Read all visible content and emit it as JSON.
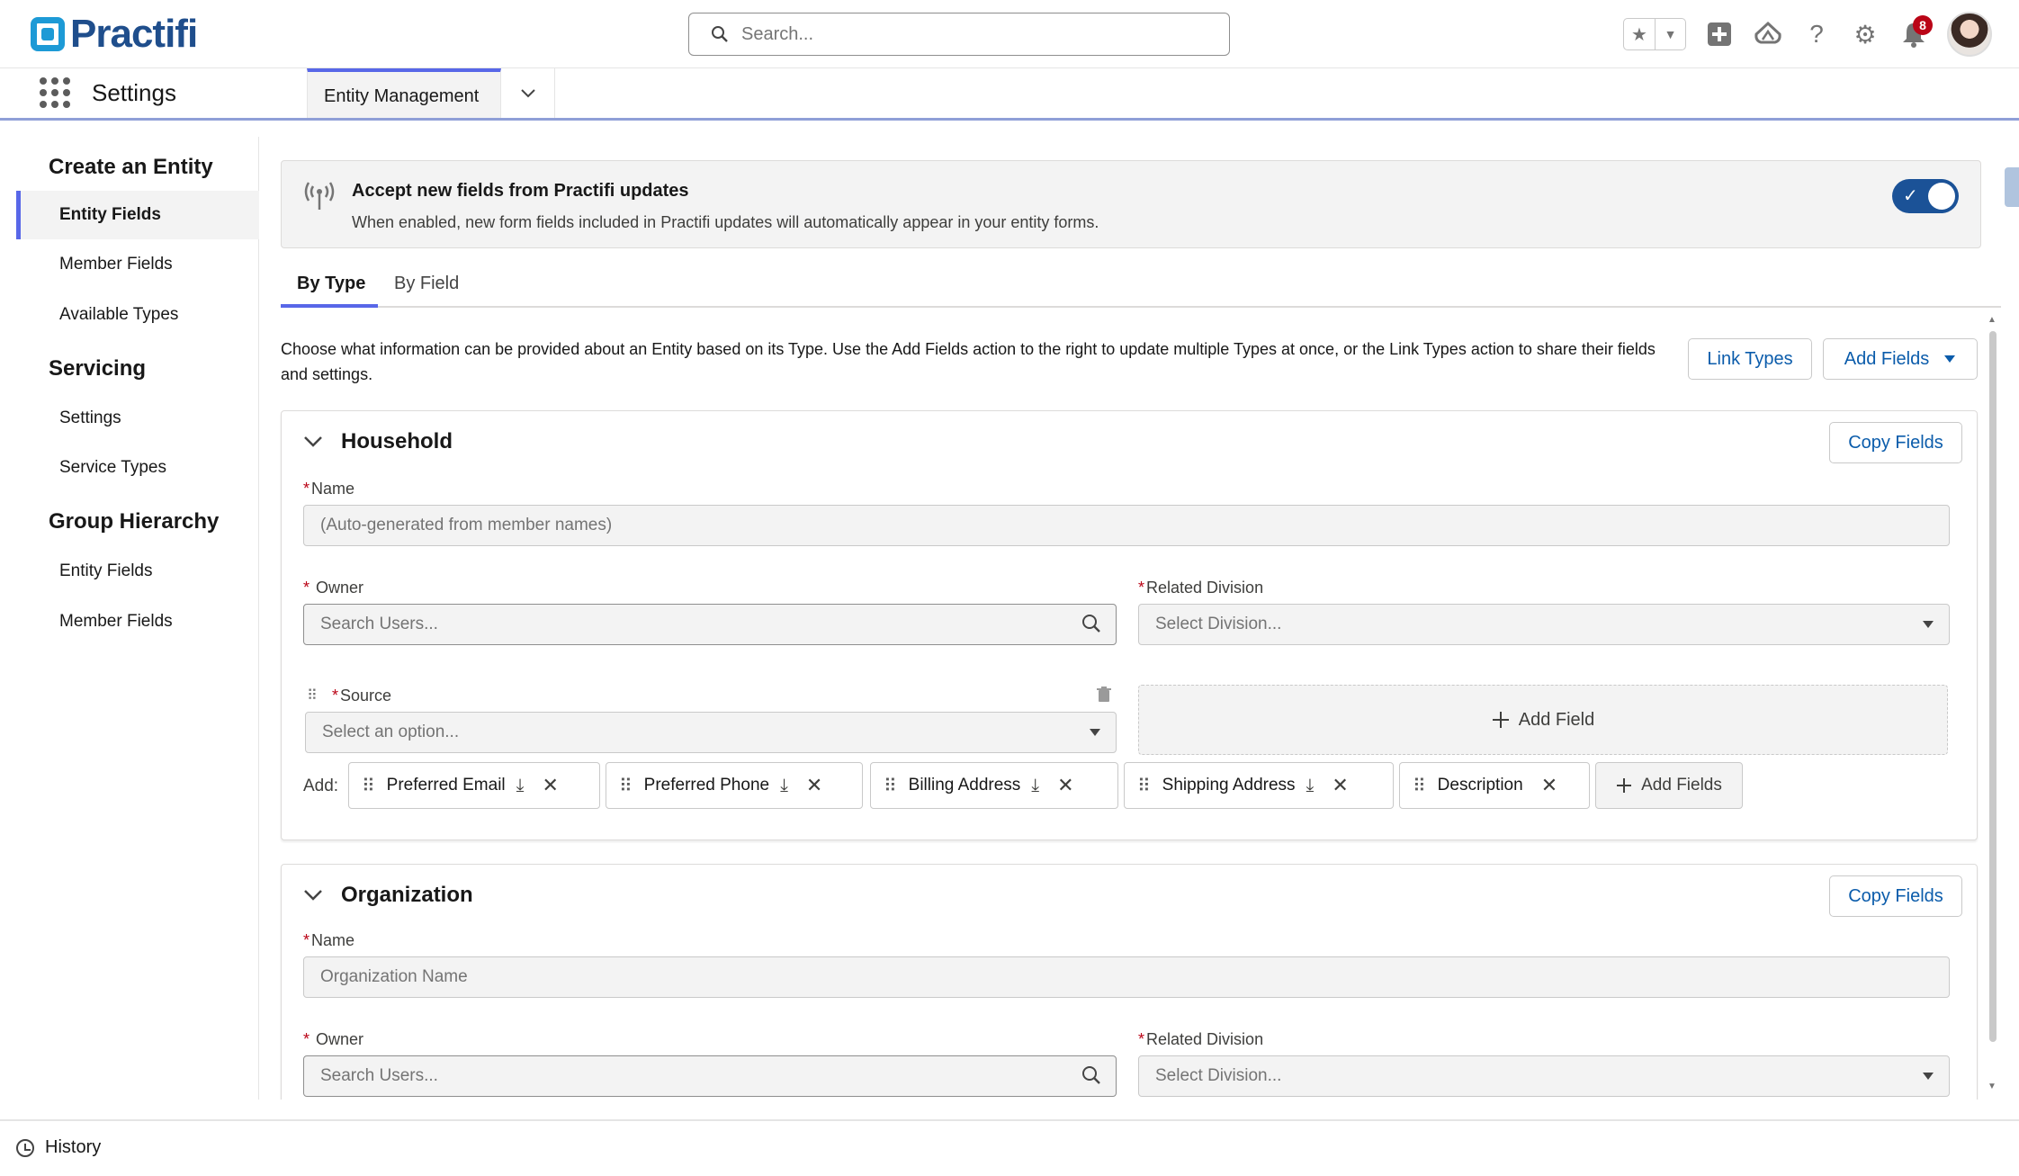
{
  "header": {
    "logo_text": "Practifi",
    "search_placeholder": "Search...",
    "notifications_count": "8"
  },
  "nav": {
    "app_name": "Settings",
    "tab_label": "Entity Management"
  },
  "sidebar": {
    "sections": [
      {
        "title": "Create an Entity",
        "items": [
          "Entity Fields",
          "Member Fields",
          "Available Types"
        ]
      },
      {
        "title": "Servicing",
        "items": [
          "Settings",
          "Service Types"
        ]
      },
      {
        "title": "Group Hierarchy",
        "items": [
          "Entity Fields",
          "Member Fields"
        ]
      }
    ],
    "active_item": "Entity Fields"
  },
  "banner": {
    "title": "Accept new fields from Practifi updates",
    "description": "When enabled, new form fields included in Practifi updates will automatically appear in your entity forms.",
    "toggle_on": true
  },
  "tabs": [
    "By Type",
    "By Field"
  ],
  "intro_text": "Choose what information can be provided about an Entity based on its Type. Use the Add Fields action to the right to update multiple Types at once, or the Link Types action to share their fields and settings.",
  "actions": {
    "link_types": "Link Types",
    "add_fields": "Add Fields"
  },
  "household": {
    "title": "Household",
    "copy_fields": "Copy Fields",
    "name_label": "Name",
    "name_placeholder": "(Auto-generated from member names)",
    "owner_label": "Owner",
    "owner_placeholder": "Search Users...",
    "division_label": "Related Division",
    "division_placeholder": "Select Division...",
    "source_label": "Source",
    "source_placeholder": "Select an option...",
    "add_field": "Add Field",
    "add_label": "Add:",
    "pills": [
      "Preferred Email",
      "Preferred Phone",
      "Billing Address",
      "Shipping Address",
      "Description"
    ],
    "add_fields": "Add Fields"
  },
  "organization": {
    "title": "Organization",
    "copy_fields": "Copy Fields",
    "name_label": "Name",
    "name_placeholder": "Organization Name",
    "owner_label": "Owner",
    "owner_placeholder": "Search Users...",
    "division_label": "Related Division",
    "division_placeholder": "Select Division..."
  },
  "footer": {
    "history": "History"
  }
}
